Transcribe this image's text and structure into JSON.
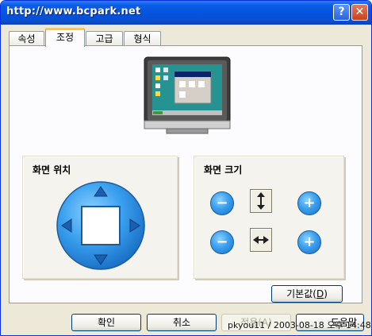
{
  "window": {
    "title": "http://www.bcpark.net",
    "help_glyph": "?",
    "close_glyph": "✕"
  },
  "tabs": [
    {
      "label": "속성",
      "active": false
    },
    {
      "label": "조정",
      "active": true
    },
    {
      "label": "고급",
      "active": false
    },
    {
      "label": "형식",
      "active": false
    }
  ],
  "position_group": {
    "title": "화면 위치"
  },
  "size_group": {
    "title": "화면 크기",
    "minus_glyph": "−",
    "plus_glyph": "+"
  },
  "buttons": {
    "default_prefix": "기본값(",
    "default_key": "D",
    "default_suffix": ")",
    "ok": "확인",
    "cancel": "취소",
    "apply": "적용(A)",
    "help": "도움말"
  },
  "watermark": "pkyou11 / 2003-08-18 오후 14:48",
  "colors": {
    "titlebar": "#0453dd",
    "tab_highlight": "#ffc83c",
    "arrow_blue": "#3aa0ef"
  }
}
